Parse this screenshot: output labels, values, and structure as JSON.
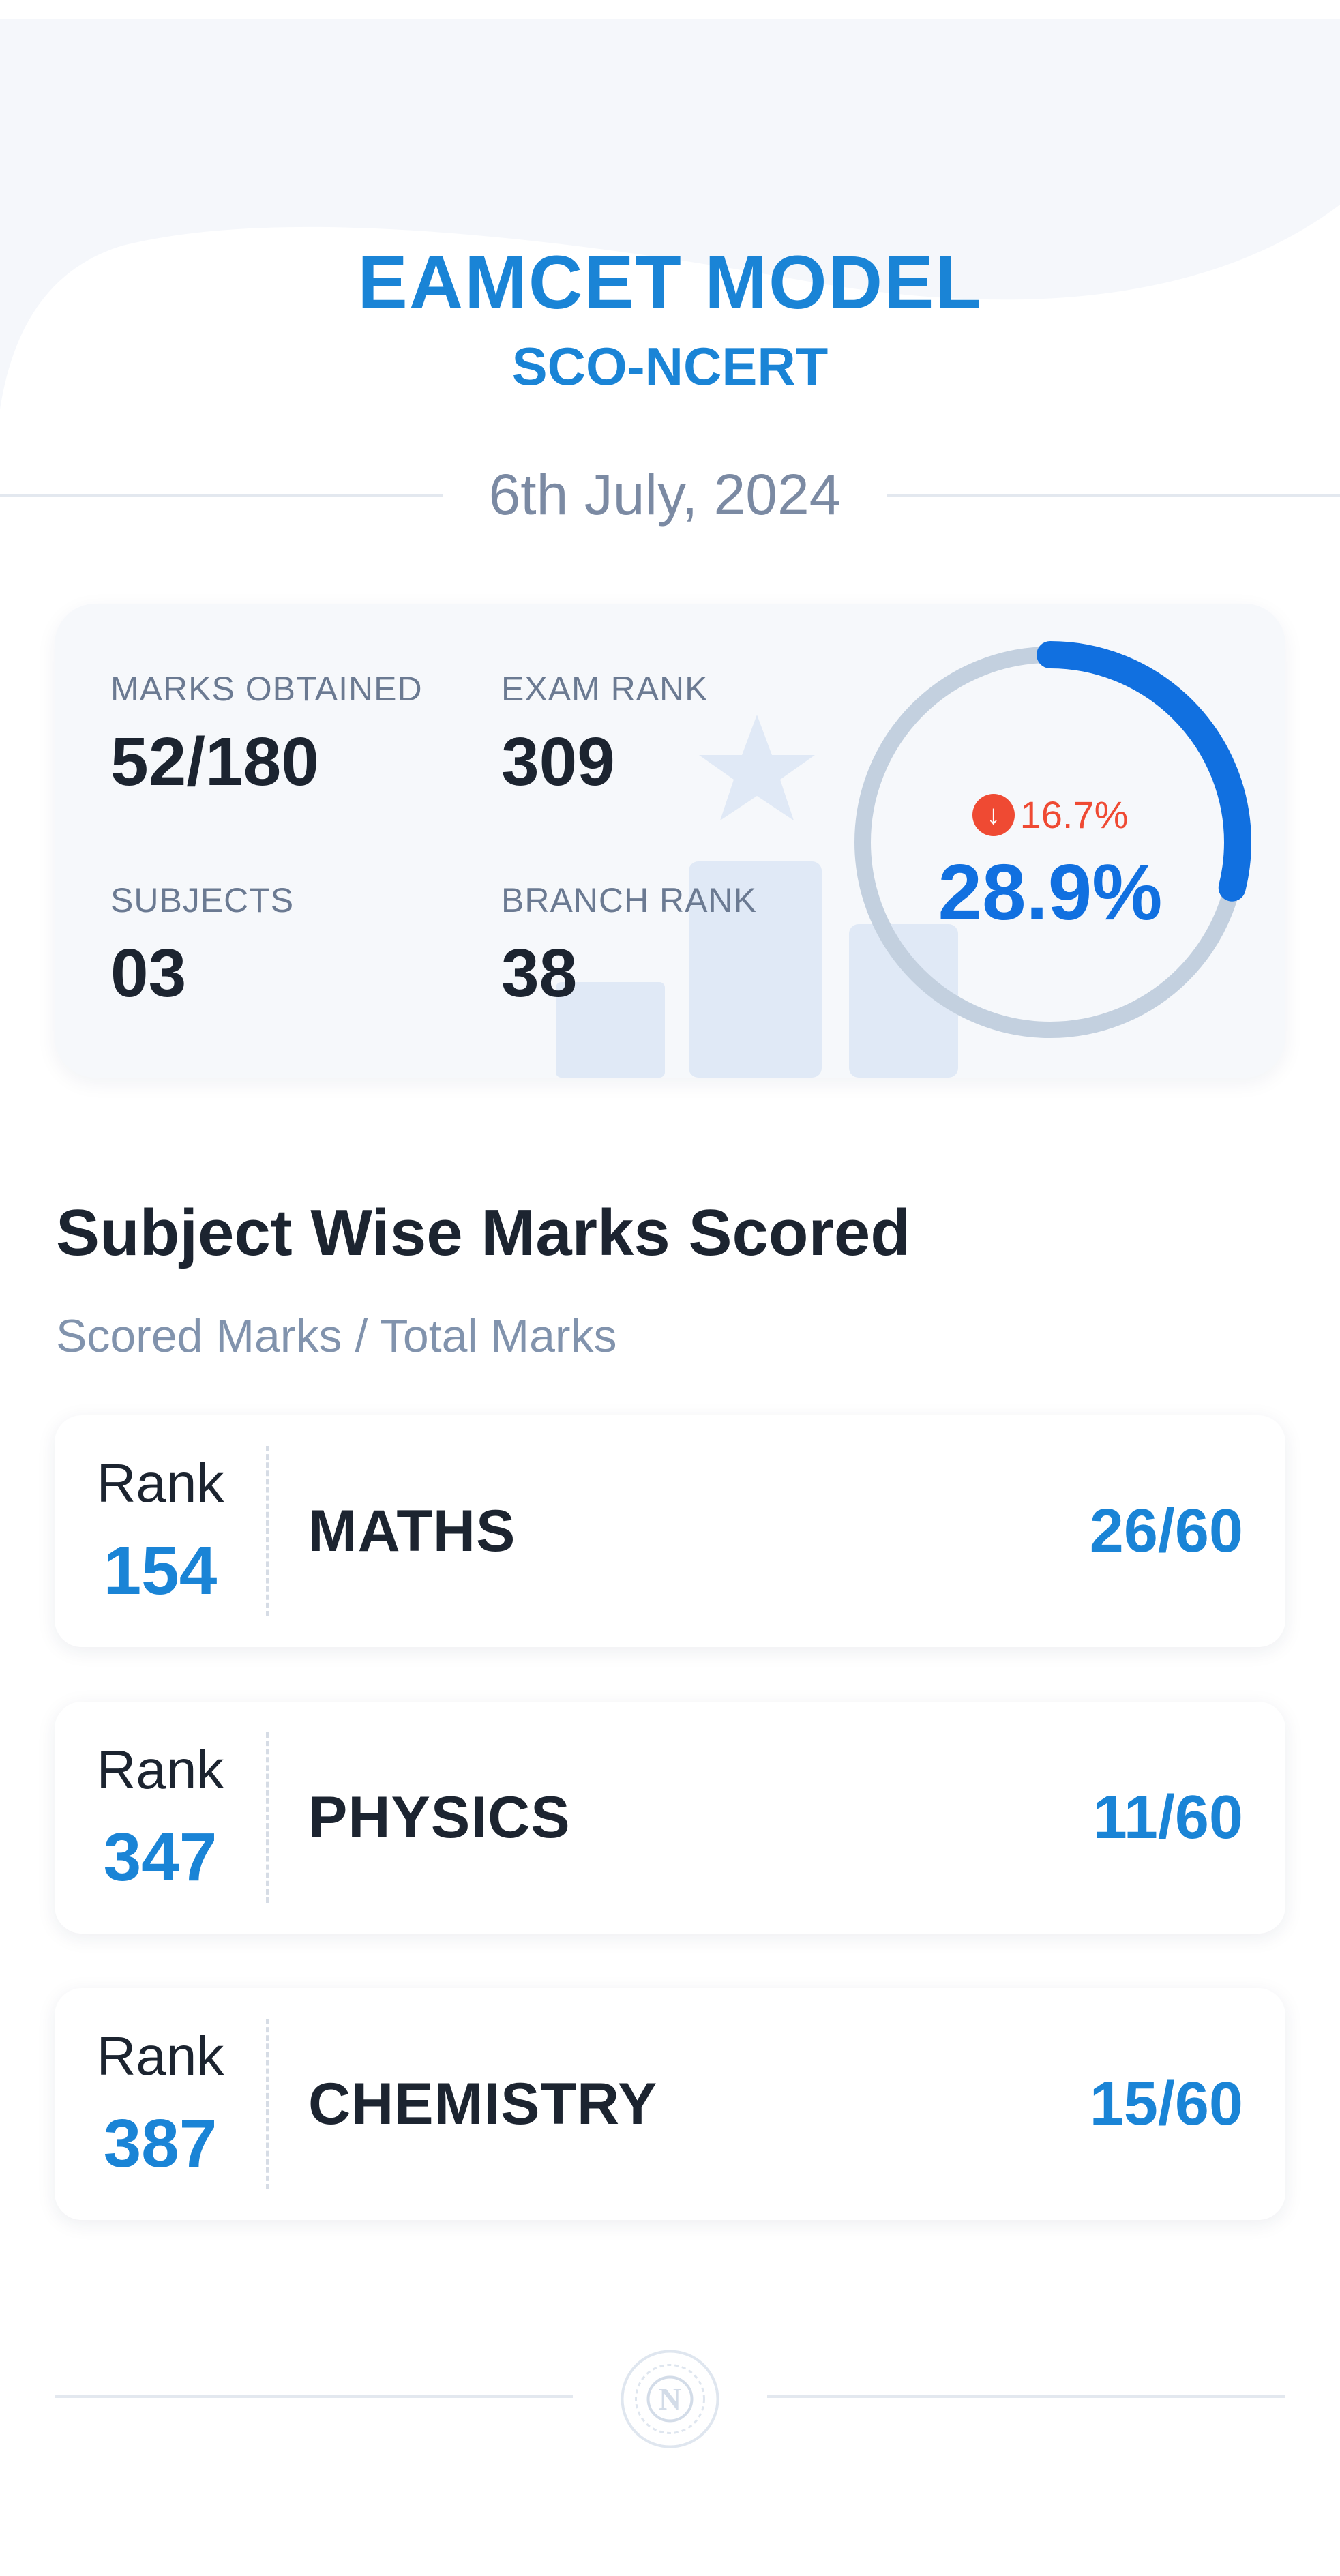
{
  "header": {
    "title": "EAMCET MODEL",
    "subtitle": "SCO-NCERT",
    "date": "6th July, 2024"
  },
  "summary": {
    "marks_obtained_label": "MARKS OBTAINED",
    "marks_obtained": "52/180",
    "exam_rank_label": "EXAM RANK",
    "exam_rank": "309",
    "subjects_label": "SUBJECTS",
    "subjects": "03",
    "branch_rank_label": "BRANCH RANK",
    "branch_rank": "38",
    "percentage": "28.9%",
    "percentage_value": 28.9,
    "change": "16.7%",
    "change_direction": "down"
  },
  "section": {
    "title": "Subject Wise Marks Scored",
    "subtitle": "Scored Marks / Total Marks"
  },
  "subjects": [
    {
      "rank_label": "Rank",
      "rank": "154",
      "name": "MATHS",
      "score": "26/60"
    },
    {
      "rank_label": "Rank",
      "rank": "347",
      "name": "PHYSICS",
      "score": "11/60"
    },
    {
      "rank_label": "Rank",
      "rank": "387",
      "name": "CHEMISTRY",
      "score": "15/60"
    }
  ],
  "footer": {
    "logo_icon": "institution-logo-icon",
    "logo_letter": "N"
  },
  "colors": {
    "accent": "#1a84d6",
    "accent_strong": "#1170e0",
    "negative": "#ef4a33",
    "ring_track": "#c3d0df"
  }
}
